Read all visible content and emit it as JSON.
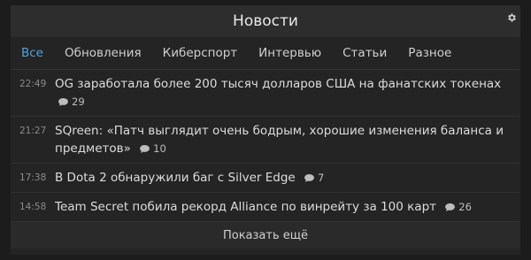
{
  "header": {
    "title": "Новости",
    "settings_icon": "gear-icon"
  },
  "tabs": [
    {
      "label": "Все",
      "active": true
    },
    {
      "label": "Обновления",
      "active": false
    },
    {
      "label": "Киберспорт",
      "active": false
    },
    {
      "label": "Интервью",
      "active": false
    },
    {
      "label": "Статьи",
      "active": false
    },
    {
      "label": "Разное",
      "active": false
    }
  ],
  "news": [
    {
      "time": "22:49",
      "title": "OG заработала более 200 тысяч долларов США на фанатских токенах",
      "comments": "29"
    },
    {
      "time": "21:27",
      "title": "SQreen: «Патч выглядит очень бодрым, хорошие изменения баланса и предметов»",
      "comments": "10"
    },
    {
      "time": "17:38",
      "title": "В Dota 2 обнаружили баг с Silver Edge",
      "comments": "7"
    },
    {
      "time": "14:58",
      "title": "Team Secret побила рекорд Alliance по винрейту за 100 карт",
      "comments": "26"
    }
  ],
  "show_more_label": "Показать ещё",
  "colors": {
    "accent": "#4aa3df",
    "background": "#1c1c1c",
    "panel": "#242424",
    "header": "#2d2d2d"
  }
}
